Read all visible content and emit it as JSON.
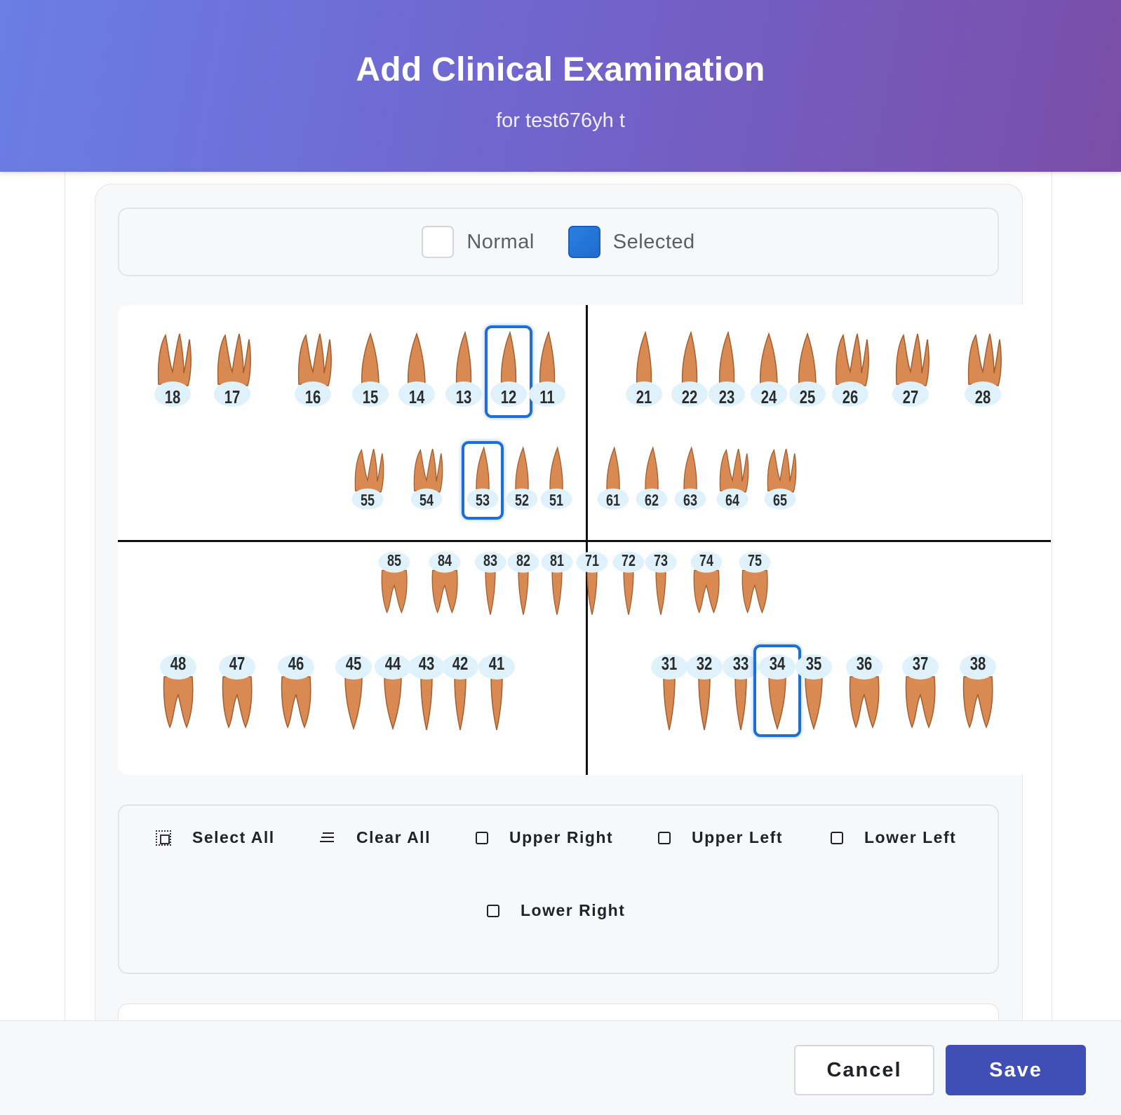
{
  "header": {
    "title": "Add Clinical Examination",
    "subtitle": "for test676yh t"
  },
  "legend": {
    "normal_label": "Normal",
    "selected_label": "Selected"
  },
  "colors": {
    "selected": "#1d6fd6",
    "root": "#d98a52",
    "crown": "#dff1fa",
    "save": "#3f4fb5"
  },
  "teeth": {
    "upper_permanent_right": [
      "18",
      "17",
      "16",
      "15",
      "14",
      "13",
      "12",
      "11"
    ],
    "upper_permanent_left": [
      "21",
      "22",
      "23",
      "24",
      "25",
      "26",
      "27",
      "28"
    ],
    "upper_primary_right": [
      "55",
      "54",
      "53",
      "52",
      "51"
    ],
    "upper_primary_left": [
      "61",
      "62",
      "63",
      "64",
      "65"
    ],
    "lower_primary_right": [
      "85",
      "84",
      "83",
      "82",
      "81"
    ],
    "lower_primary_left": [
      "71",
      "72",
      "73",
      "74",
      "75"
    ],
    "lower_permanent_right": [
      "48",
      "47",
      "46",
      "45",
      "44",
      "43",
      "42",
      "41"
    ],
    "lower_permanent_left": [
      "31",
      "32",
      "33",
      "34",
      "35",
      "36",
      "37",
      "38"
    ],
    "selected": [
      "12",
      "53",
      "34"
    ]
  },
  "actions": {
    "select_all": "Select All",
    "clear_all": "Clear All",
    "upper_right": "Upper Right",
    "upper_left": "Upper Left",
    "lower_left": "Lower Left",
    "lower_right": "Lower Right"
  },
  "footer": {
    "cancel_label": "Cancel",
    "save_label": "Save"
  }
}
